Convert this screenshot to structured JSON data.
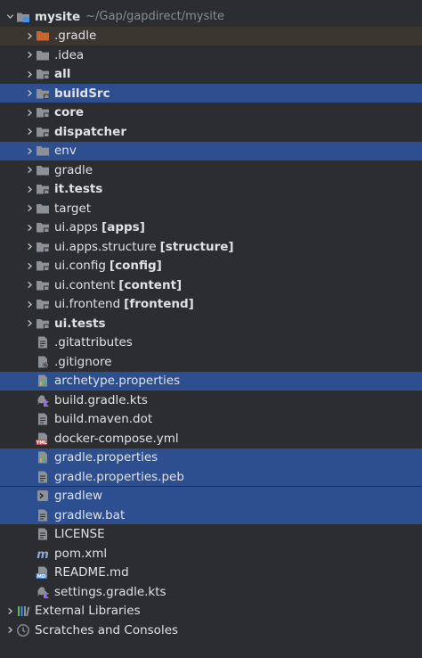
{
  "project": {
    "name": "mysite",
    "path": "~/Gap/gapdirect/mysite"
  },
  "items": [
    {
      "label": ".gradle",
      "type": "folder-orange",
      "expandable": true
    },
    {
      "label": ".idea",
      "type": "folder",
      "expandable": true
    },
    {
      "label": "all",
      "type": "module",
      "bold": true,
      "expandable": true
    },
    {
      "label": "buildSrc",
      "type": "module",
      "bold": true,
      "expandable": true,
      "selected": true
    },
    {
      "label": "core",
      "type": "module",
      "bold": true,
      "expandable": true
    },
    {
      "label": "dispatcher",
      "type": "module",
      "bold": true,
      "expandable": true
    },
    {
      "label": "env",
      "type": "folder",
      "expandable": true,
      "selected": true
    },
    {
      "label": "gradle",
      "type": "folder",
      "expandable": true
    },
    {
      "label": "it.tests",
      "type": "module",
      "bold": true,
      "expandable": true
    },
    {
      "label": "target",
      "type": "folder",
      "expandable": true
    },
    {
      "label": "ui.apps",
      "module": "[apps]",
      "type": "module",
      "expandable": true
    },
    {
      "label": "ui.apps.structure",
      "module": "[structure]",
      "type": "module",
      "expandable": true
    },
    {
      "label": "ui.config",
      "module": "[config]",
      "type": "module",
      "expandable": true
    },
    {
      "label": "ui.content",
      "module": "[content]",
      "type": "module",
      "expandable": true
    },
    {
      "label": "ui.frontend",
      "module": "[frontend]",
      "type": "module",
      "expandable": true
    },
    {
      "label": "ui.tests",
      "type": "module",
      "bold": true,
      "expandable": true
    },
    {
      "label": ".gitattributes",
      "type": "file-text"
    },
    {
      "label": ".gitignore",
      "type": "file-ignore"
    },
    {
      "label": "archetype.properties",
      "type": "file-props",
      "selected": true
    },
    {
      "label": "build.gradle.kts",
      "type": "file-kts"
    },
    {
      "label": "build.maven.dot",
      "type": "file-text"
    },
    {
      "label": "docker-compose.yml",
      "type": "file-yml"
    },
    {
      "label": "gradle.properties",
      "type": "file-props",
      "selected": true
    },
    {
      "label": "gradle.properties.peb",
      "type": "file-text",
      "selected": true
    },
    {
      "label": "gradlew",
      "type": "file-shell",
      "selected": true
    },
    {
      "label": "gradlew.bat",
      "type": "file-text",
      "selected": true
    },
    {
      "label": "LICENSE",
      "type": "file-text"
    },
    {
      "label": "pom.xml",
      "type": "file-maven"
    },
    {
      "label": "README.md",
      "type": "file-md"
    },
    {
      "label": "settings.gradle.kts",
      "type": "file-kts"
    }
  ],
  "footer": [
    {
      "label": "External Libraries",
      "type": "libraries"
    },
    {
      "label": "Scratches and Consoles",
      "type": "scratches"
    }
  ],
  "colors": {
    "background": "#2b2d30",
    "selection": "#2e4f8f",
    "text": "#dfe1e5",
    "folder": "#8c9097",
    "folder_excluded": "#c7662d"
  }
}
